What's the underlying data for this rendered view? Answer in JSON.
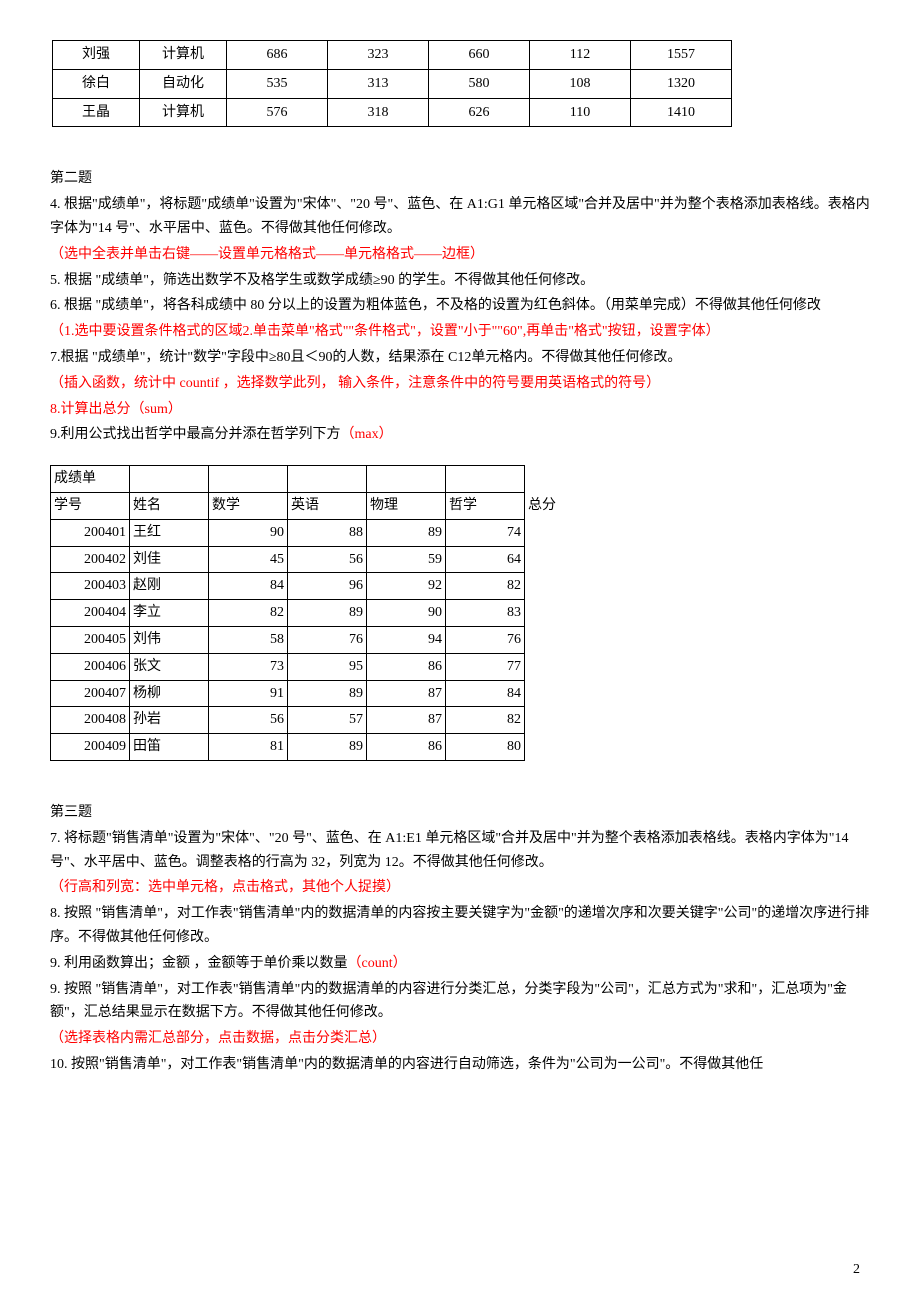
{
  "table1": {
    "rows": [
      [
        "刘强",
        "计算机",
        "686",
        "323",
        "660",
        "112",
        "1557"
      ],
      [
        "徐白",
        "自动化",
        "535",
        "313",
        "580",
        "108",
        "1320"
      ],
      [
        "王晶",
        "计算机",
        "576",
        "318",
        "626",
        "110",
        "1410"
      ]
    ]
  },
  "section2": {
    "heading": "第二题",
    "q4": "4. 根据\"成绩单\"，将标题\"成绩单\"设置为\"宋体\"、\"20 号\"、蓝色、在 A1:G1 单元格区域\"合并及居中\"并为整个表格添加表格线。表格内字体为\"14 号\"、水平居中、蓝色。不得做其他任何修改。",
    "q4_note": "（选中全表并单击右键——设置单元格格式——单元格格式——边框）",
    "q5": "5. 根据  \"成绩单\"，筛选出数学不及格学生或数学成绩≥90 的学生。不得做其他任何修改。",
    "q6": "6. 根据  \"成绩单\"，将各科成绩中 80 分以上的设置为粗体蓝色，不及格的设置为红色斜体。（用菜单完成）不得做其他任何修改",
    "q6_note": "（1.选中要设置条件格式的区域2.单击菜单\"格式\"\"条件格式\"，设置\"小于\"\"60\",再单击\"格式\"按钮，设置字体）",
    "q7": "7.根据 \"成绩单\"，统计\"数学\"字段中≥80且＜90的人数，结果添在 C12单元格内。不得做其他任何修改。",
    "q7_note": "（插入函数，统计中 countif   ，选择数学此列，   输入条件，注意条件中的符号要用英语格式的符号）",
    "q8": "8.计算出总分（sum）",
    "q9_a": "9.利用公式找出哲学中最高分并添在哲学列下方",
    "q9_b": "（max）"
  },
  "table2": {
    "title": "成绩单",
    "headers": [
      "学号",
      "姓名",
      "数学",
      "英语",
      "物理",
      "哲学"
    ],
    "totalHeader": "总分",
    "rows": [
      [
        "200401",
        "王红",
        "90",
        "88",
        "89",
        "74"
      ],
      [
        "200402",
        "刘佳",
        "45",
        "56",
        "59",
        "64"
      ],
      [
        "200403",
        "赵刚",
        "84",
        "96",
        "92",
        "82"
      ],
      [
        "200404",
        "李立",
        "82",
        "89",
        "90",
        "83"
      ],
      [
        "200405",
        "刘伟",
        "58",
        "76",
        "94",
        "76"
      ],
      [
        "200406",
        "张文",
        "73",
        "95",
        "86",
        "77"
      ],
      [
        "200407",
        "杨柳",
        "91",
        "89",
        "87",
        "84"
      ],
      [
        "200408",
        "孙岩",
        "56",
        "57",
        "87",
        "82"
      ],
      [
        "200409",
        "田笛",
        "81",
        "89",
        "86",
        "80"
      ]
    ]
  },
  "section3": {
    "heading": "第三题",
    "q7": "7. 将标题\"销售清单\"设置为\"宋体\"、\"20 号\"、蓝色、在 A1:E1 单元格区域\"合并及居中\"并为整个表格添加表格线。表格内字体为\"14 号\"、水平居中、蓝色。调整表格的行高为 32，列宽为 12。不得做其他任何修改。",
    "q7_note": "（行高和列宽：选中单元格，点击格式，其他个人捉摸）",
    "q8": "8. 按照  \"销售清单\"，对工作表\"销售清单\"内的数据清单的内容按主要关键字为\"金额\"的递增次序和次要关键字\"公司\"的递增次序进行排序。不得做其他任何修改。",
    "q9a_a": "9. 利用函数算出；金额  ，金额等于单价乘以数量",
    "q9a_b": "（count）",
    "q9b": "9. 按照  \"销售清单\"，对工作表\"销售清单\"内的数据清单的内容进行分类汇总，分类字段为\"公司\"，汇总方式为\"求和\"，汇总项为\"金额\"，汇总结果显示在数据下方。不得做其他任何修改。",
    "q9b_note": "（选择表格内需汇总部分，点击数据，点击分类汇总）",
    "q10": "10. 按照\"销售清单\"，对工作表\"销售清单\"内的数据清单的内容进行自动筛选，条件为\"公司为一公司\"。不得做其他任"
  },
  "pageNumber": "2"
}
